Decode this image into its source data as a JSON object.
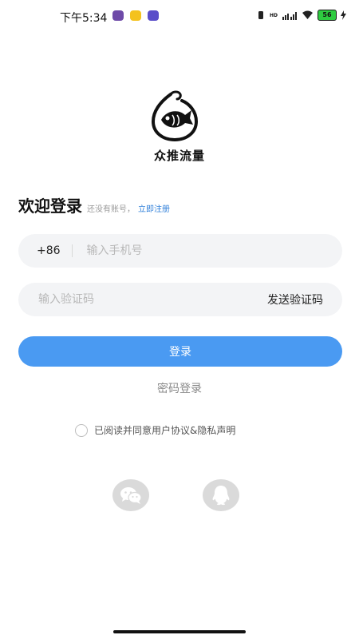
{
  "status_bar": {
    "time": "下午5:34",
    "hd": "HD",
    "battery_level": "56"
  },
  "brand": {
    "name": "众推流量"
  },
  "login": {
    "title": "欢迎登录",
    "no_account_text": "还没有账号，",
    "register_link": "立即注册",
    "country_code": "+86",
    "phone_placeholder": "输入手机号",
    "code_placeholder": "输入验证码",
    "send_code_label": "发送验证码",
    "login_button_label": "登录",
    "password_login_label": "密码登录",
    "agreement_text": "已阅读并同意用户协议&隐私声明"
  },
  "social": {
    "icons": [
      "wechat-icon",
      "qq-icon"
    ]
  },
  "colors": {
    "accent": "#4a9af2",
    "link": "#2f7fd9",
    "field_bg": "#f3f4f6",
    "social_bg": "#dadada"
  }
}
